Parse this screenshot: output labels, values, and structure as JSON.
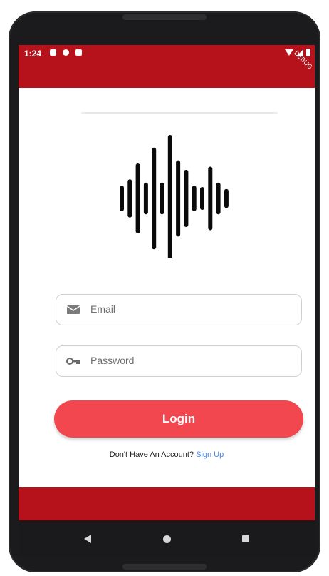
{
  "status_bar": {
    "time": "1:24",
    "left_icons": [
      "notification-icon",
      "sync-icon",
      "sd-card-icon"
    ],
    "right_icons": [
      "wifi-icon",
      "signal-icon",
      "battery-icon"
    ],
    "debug_label": "DEBUG",
    "color": "#b5121b"
  },
  "logo": {
    "icon": "sound-wave-icon",
    "bar_levels": [
      0.2,
      0.3,
      0.55,
      0.25,
      0.8,
      0.25,
      1.0,
      0.6,
      0.45,
      0.2,
      0.18,
      0.5,
      0.25,
      0.15
    ]
  },
  "form": {
    "email": {
      "placeholder": "Email",
      "icon": "mail-icon"
    },
    "password": {
      "placeholder": "Password",
      "icon": "key-icon"
    }
  },
  "login_button": {
    "label": "Login",
    "color": "#f2474f"
  },
  "signup": {
    "prompt": "Don't Have An Account?",
    "link": "Sign Up"
  },
  "accent_color": "#b5121b",
  "nav": {
    "icons": [
      "back-icon",
      "home-icon",
      "recent-apps-icon"
    ]
  }
}
